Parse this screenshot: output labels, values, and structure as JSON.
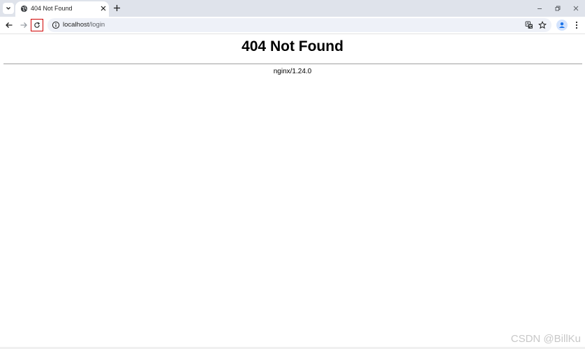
{
  "browser": {
    "tab": {
      "title": "404 Not Found"
    },
    "address_bar": {
      "host": "localhost",
      "path": "/login"
    }
  },
  "page": {
    "heading": "404 Not Found",
    "server_signature": "nginx/1.24.0"
  },
  "watermark": "CSDN @BillKu",
  "colors": {
    "tabstrip_bg": "#dfe3eb",
    "omnibox_bg": "#eef1f8",
    "highlight_border": "#d00000",
    "profile_accent": "#1a73e8"
  },
  "icons": [
    "tab-search-icon",
    "globe-icon",
    "close-icon",
    "plus-icon",
    "minimize-icon",
    "restore-icon",
    "window-close-icon",
    "back-arrow-icon",
    "forward-arrow-icon",
    "reload-icon",
    "info-icon",
    "translate-icon",
    "star-icon",
    "profile-icon",
    "more-vert-icon"
  ]
}
